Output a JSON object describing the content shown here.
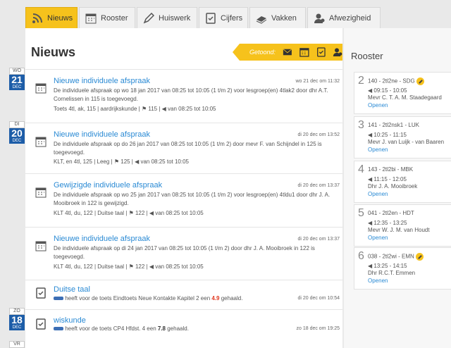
{
  "tabs": [
    {
      "label": "Nieuws",
      "icon": "rss-icon"
    },
    {
      "label": "Rooster",
      "icon": "calendar-icon"
    },
    {
      "label": "Huiswerk",
      "icon": "pencil-icon"
    },
    {
      "label": "Cijfers",
      "icon": "grade-icon"
    },
    {
      "label": "Vakken",
      "icon": "books-icon"
    },
    {
      "label": "Afwezigheid",
      "icon": "person-icon"
    }
  ],
  "nieuws": {
    "title": "Nieuws",
    "getoond_label": "Getoond:",
    "filter_icons": [
      "envelope-icon",
      "calendar-icon",
      "grade-icon",
      "person-icon"
    ]
  },
  "date_badges": [
    {
      "day": "WO",
      "num": "21",
      "month": "DEC"
    },
    {
      "day": "DI",
      "num": "20",
      "month": "DEC"
    },
    {
      "day": "ZO",
      "num": "18",
      "month": "DEC"
    },
    {
      "day": "VR",
      "num": "",
      "month": ""
    }
  ],
  "items": [
    {
      "title": "Nieuwe individuele afspraak",
      "date": "wo 21 dec om 11:32",
      "body": "De individuele afspraak op wo 18 jan 2017 van 08:25 tot 10:05 (1 t/m 2) voor lesgroep(en) 4tlak2 door dhr A.T. Cornelissen in 115 is toegevoegd.",
      "meta": "Toets 4tl, ak, 115 | aardrijkskunde | ⚑ 115 | ◀ van 08:25 tot 10:05"
    },
    {
      "title": "Nieuwe individuele afspraak",
      "date": "di 20 dec om 13:52",
      "body": "De individuele afspraak op do 26 jan 2017 van 08:25 tot 10:05 (1 t/m 2) door mevr F. van Schijndel in 125 is toegevoegd.",
      "meta": "KLT, en 4tl, 125 | Leeg | ⚑ 125 | ◀ van 08:25 tot 10:05"
    },
    {
      "title": "Gewijzigde individuele afspraak",
      "date": "di 20 dec om 13:37",
      "body": "De individuele afspraak op wo 25 jan 2017 van 08:25 tot 10:05 (1 t/m 2) voor lesgroep(en) 4tldu1 door dhr J. A. Mooibroek in 122 is gewijzigd.",
      "meta": "KLT 4tl, du, 122 | Duitse taal | ⚑ 122 | ◀ van 08:25 tot 10:05"
    },
    {
      "title": "Nieuwe individuele afspraak",
      "date": "di 20 dec om 13:37",
      "body": "De individuele afspraak op di 24 jan 2017 van 08:25 tot 10:05 (1 t/m 2) door dhr J. A. Mooibroek in 122 is toegevoegd.",
      "meta": "KLT 4tl, du, 122 | Duitse taal | ⚑ 122 | ◀ van 08:25 tot 10:05"
    },
    {
      "title": "Duitse taal",
      "date": "di 20 dec om 10:54",
      "body_pre": "heeft voor de toets Eindtoets Neue Kontakte Kapitel 2 een ",
      "grade": "4.9",
      "body_post": " gehaald."
    },
    {
      "title": "wiskunde",
      "date": "zo 18 dec om 19:25",
      "body_pre": "heeft voor de toets CP4 Hfdst. 4 een ",
      "grade": "7.8",
      "body_post": " gehaald."
    }
  ],
  "rooster": {
    "title": "Rooster",
    "slots": [
      {
        "num": "2",
        "line": "140 - 2tl2ne - SDG",
        "time": "◀ 09:15 - 10:05",
        "teacher": "Mevr C. T. A. M. Staadegaard",
        "open": "Openen",
        "edit": true
      },
      {
        "num": "3",
        "line": "141 - 2tl2nsk1 - LUK",
        "time": "◀ 10:25 - 11:15",
        "teacher": "Mevr J. van Luijk - van Baaren",
        "open": "Openen",
        "edit": false
      },
      {
        "num": "4",
        "line": "143 - 2tl2bi - MBK",
        "time": "◀ 11:15 - 12:05",
        "teacher": "Dhr J. A. Mooibroek",
        "open": "Openen",
        "edit": false
      },
      {
        "num": "5",
        "line": "041 - 2tl2en - HDT",
        "time": "◀ 12:35 - 13:25",
        "teacher": "Mevr W. J. M. van Houdt",
        "open": "Openen",
        "edit": false
      },
      {
        "num": "6",
        "line": "038 - 2tl2wi - EMN",
        "time": "◀ 13:25 - 14:15",
        "teacher": "Dhr R.C.T. Emmen",
        "open": "Openen",
        "edit": true
      }
    ]
  }
}
